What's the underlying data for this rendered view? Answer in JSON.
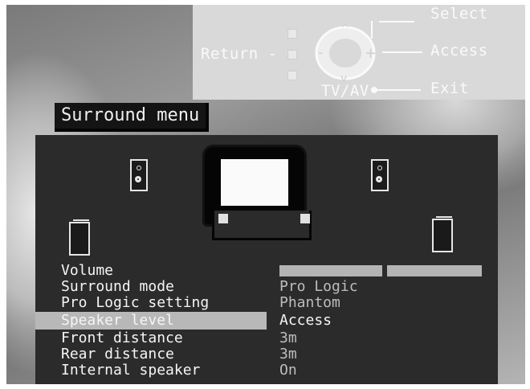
{
  "help": {
    "select": "Select",
    "access": "Access",
    "exit": "Exit",
    "return": "Return -",
    "tvav": "TV/AV"
  },
  "menu": {
    "title": "Surround menu",
    "items": [
      {
        "label": "Volume",
        "value": "",
        "control": "bars"
      },
      {
        "label": "Surround mode",
        "value": "Pro Logic"
      },
      {
        "label": "Pro Logic setting",
        "value": "Phantom"
      },
      {
        "label": "Speaker level",
        "value": "Access",
        "selected": true
      },
      {
        "label": "Front distance",
        "value": "3m"
      },
      {
        "label": "Rear distance",
        "value": "3m"
      },
      {
        "label": "Internal speaker",
        "value": "On"
      }
    ]
  },
  "icons": {
    "remote": "remote-control-dpad-icon",
    "speakers": "speaker-icon",
    "tv": "tv-icon"
  },
  "colors": {
    "panel": "#2b2b2b",
    "highlight": "#b8b8b8",
    "help_bg": "#d9d9d9"
  }
}
